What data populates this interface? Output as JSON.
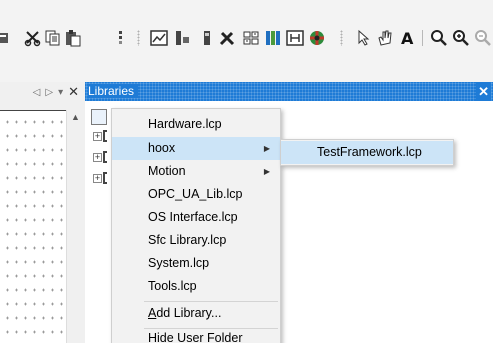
{
  "toolbar": {
    "icons": [
      "delete-icon",
      "cut-icon",
      "copy-icon",
      "paste-icon",
      "variable-icon",
      "chart-icon",
      "trace-icon",
      "build-icon",
      "tools-icon",
      "grid-icon",
      "columns-icon",
      "hierarchy-icon",
      "ball-icon",
      "pointer-icon",
      "hand-icon",
      "font-icon",
      "zoom-icon",
      "zoom-in-icon",
      "zoom-out-icon"
    ]
  },
  "left_panel": {
    "nav_prev": "◁",
    "nav_next": "▷",
    "dropdown": "▾",
    "close": "✕",
    "scroll_up": "▲"
  },
  "libraries_panel": {
    "title": "Libraries",
    "close": "✕",
    "accent": "#1e7bd6"
  },
  "context_menu": {
    "items": [
      {
        "label": "Hardware.lcp",
        "submenu": false
      },
      {
        "label": "hoox",
        "submenu": true,
        "highlighted": true
      },
      {
        "label": "Motion",
        "submenu": true
      },
      {
        "label": "OPC_UA_Lib.lcp",
        "submenu": false
      },
      {
        "label": "OS Interface.lcp",
        "submenu": false
      },
      {
        "label": "Sfc Library.lcp",
        "submenu": false
      },
      {
        "label": "System.lcp",
        "submenu": false
      },
      {
        "label": "Tools.lcp",
        "submenu": false
      }
    ],
    "add_library": {
      "accel": "A",
      "rest": "dd Library..."
    },
    "hide_user_folder": "Hide User Folder",
    "submenu_arrow": "▶"
  },
  "submenu": {
    "items": [
      {
        "label": "TestFramework.lcp"
      }
    ]
  }
}
